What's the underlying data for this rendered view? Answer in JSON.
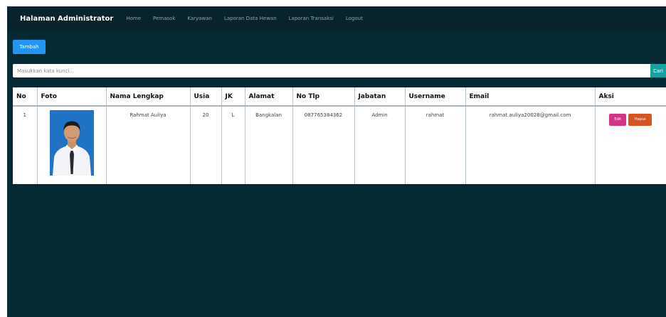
{
  "navbar": {
    "brand": "Halaman Administrator",
    "items": [
      "Home",
      "Pemasok",
      "Karyawan",
      "Laporan Data Hewan",
      "Laporan Transaksi",
      "Logout"
    ]
  },
  "toolbar": {
    "add_label": "Tambah"
  },
  "search": {
    "placeholder": "Masukkan kata kunci...",
    "value": "",
    "button_label": "Cari"
  },
  "table": {
    "columns": [
      "No",
      "Foto",
      "Nama Lengkap",
      "Usia",
      "JK",
      "Alamat",
      "No Tlp",
      "Jabatan",
      "Username",
      "Email",
      "Aksi"
    ],
    "rows": [
      {
        "no": "1",
        "photo": "employee-photo",
        "nama": "Rahmat Auliya",
        "usia": "20",
        "jk": "L",
        "alamat": "Bangkalan",
        "telp": "087765384362",
        "jabatan": "Admin",
        "username": "rahmat",
        "email": "rahmat.auliya20028@gmail.com",
        "edit_label": "Edit",
        "delete_label": "Hapus"
      }
    ]
  },
  "colors": {
    "background": "#062a33",
    "navbar": "#08232c",
    "primary": "#2196f3",
    "search_button": "#17a2a2",
    "edit": "#d63384",
    "delete": "#d9531e"
  }
}
